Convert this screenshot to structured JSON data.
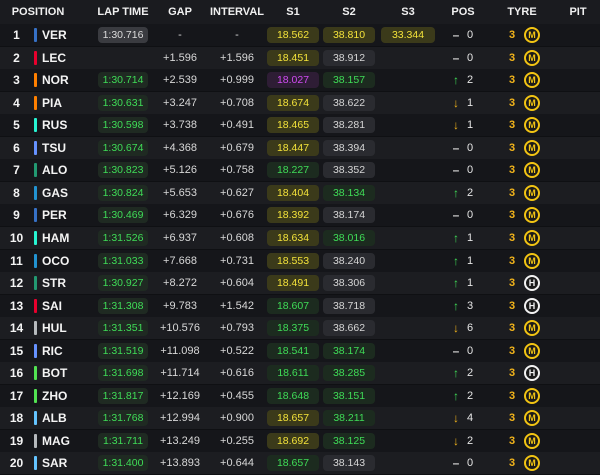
{
  "header": {
    "position": "POSITION",
    "lap_time": "LAP TIME",
    "gap": "GAP",
    "interval": "INTERVAL",
    "s1": "S1",
    "s2": "S2",
    "s3": "S3",
    "pos": "POS",
    "tyre": "TYRE",
    "pit": "PIT"
  },
  "colors": {
    "yellow_sector": "#f3e23a",
    "green_sector": "#3fdc57",
    "purple_sector": "#d04bf2",
    "medium_tyre": "#f2c413",
    "hard_tyre": "#f2f2f2"
  },
  "rows": [
    {
      "pos": "1",
      "driver": "VER",
      "team_color": "#3671c6",
      "lap": "1:30.716",
      "lap_style": "best",
      "gap": "-",
      "interval": "-",
      "s1": "18.562",
      "s1c": "yellow",
      "s2": "38.810",
      "s2c": "yellow",
      "s3": "33.344",
      "s3c": "yellow",
      "change_icon": "same",
      "change": "0",
      "tyre_laps": "3",
      "tyre": "M",
      "tyre_type": "medium"
    },
    {
      "pos": "2",
      "driver": "LEC",
      "team_color": "#e8002d",
      "lap": "",
      "lap_style": "none",
      "gap": "+1.596",
      "interval": "+1.596",
      "s1": "18.451",
      "s1c": "yellow",
      "s2": "38.912",
      "s2c": "grey",
      "s3": "",
      "s3c": "none",
      "change_icon": "same",
      "change": "0",
      "tyre_laps": "3",
      "tyre": "M",
      "tyre_type": "medium"
    },
    {
      "pos": "3",
      "driver": "NOR",
      "team_color": "#ff8000",
      "lap": "1:30.714",
      "lap_style": "pb",
      "gap": "+2.539",
      "interval": "+0.999",
      "s1": "18.027",
      "s1c": "purple",
      "s2": "38.157",
      "s2c": "green",
      "s3": "",
      "s3c": "none",
      "change_icon": "up",
      "change": "2",
      "tyre_laps": "3",
      "tyre": "M",
      "tyre_type": "medium"
    },
    {
      "pos": "4",
      "driver": "PIA",
      "team_color": "#ff8000",
      "lap": "1:30.631",
      "lap_style": "pb",
      "gap": "+3.247",
      "interval": "+0.708",
      "s1": "18.674",
      "s1c": "yellow",
      "s2": "38.622",
      "s2c": "grey",
      "s3": "",
      "s3c": "none",
      "change_icon": "down",
      "change": "1",
      "tyre_laps": "3",
      "tyre": "M",
      "tyre_type": "medium"
    },
    {
      "pos": "5",
      "driver": "RUS",
      "team_color": "#27f4d2",
      "lap": "1:30.598",
      "lap_style": "pb",
      "gap": "+3.738",
      "interval": "+0.491",
      "s1": "18.465",
      "s1c": "yellow",
      "s2": "38.281",
      "s2c": "grey",
      "s3": "",
      "s3c": "none",
      "change_icon": "down",
      "change": "1",
      "tyre_laps": "3",
      "tyre": "M",
      "tyre_type": "medium"
    },
    {
      "pos": "6",
      "driver": "TSU",
      "team_color": "#6692ff",
      "lap": "1:30.674",
      "lap_style": "pb",
      "gap": "+4.368",
      "interval": "+0.679",
      "s1": "18.447",
      "s1c": "yellow",
      "s2": "38.394",
      "s2c": "grey",
      "s3": "",
      "s3c": "none",
      "change_icon": "same",
      "change": "0",
      "tyre_laps": "3",
      "tyre": "M",
      "tyre_type": "medium"
    },
    {
      "pos": "7",
      "driver": "ALO",
      "team_color": "#229971",
      "lap": "1:30.823",
      "lap_style": "pb",
      "gap": "+5.126",
      "interval": "+0.758",
      "s1": "18.227",
      "s1c": "green",
      "s2": "38.352",
      "s2c": "grey",
      "s3": "",
      "s3c": "none",
      "change_icon": "same",
      "change": "0",
      "tyre_laps": "3",
      "tyre": "M",
      "tyre_type": "medium"
    },
    {
      "pos": "8",
      "driver": "GAS",
      "team_color": "#2293d1",
      "lap": "1:30.824",
      "lap_style": "pb",
      "gap": "+5.653",
      "interval": "+0.627",
      "s1": "18.404",
      "s1c": "yellow",
      "s2": "38.134",
      "s2c": "green",
      "s3": "",
      "s3c": "none",
      "change_icon": "up",
      "change": "2",
      "tyre_laps": "3",
      "tyre": "M",
      "tyre_type": "medium"
    },
    {
      "pos": "9",
      "driver": "PER",
      "team_color": "#3671c6",
      "lap": "1:30.469",
      "lap_style": "pb",
      "gap": "+6.329",
      "interval": "+0.676",
      "s1": "18.392",
      "s1c": "yellow",
      "s2": "38.174",
      "s2c": "grey",
      "s3": "",
      "s3c": "none",
      "change_icon": "same",
      "change": "0",
      "tyre_laps": "3",
      "tyre": "M",
      "tyre_type": "medium"
    },
    {
      "pos": "10",
      "driver": "HAM",
      "team_color": "#27f4d2",
      "lap": "1:31.526",
      "lap_style": "pb",
      "gap": "+6.937",
      "interval": "+0.608",
      "s1": "18.634",
      "s1c": "yellow",
      "s2": "38.016",
      "s2c": "green",
      "s3": "",
      "s3c": "none",
      "change_icon": "up",
      "change": "1",
      "tyre_laps": "3",
      "tyre": "M",
      "tyre_type": "medium"
    },
    {
      "pos": "11",
      "driver": "OCO",
      "team_color": "#2293d1",
      "lap": "1:31.033",
      "lap_style": "pb",
      "gap": "+7.668",
      "interval": "+0.731",
      "s1": "18.553",
      "s1c": "yellow",
      "s2": "38.240",
      "s2c": "grey",
      "s3": "",
      "s3c": "none",
      "change_icon": "up",
      "change": "1",
      "tyre_laps": "3",
      "tyre": "M",
      "tyre_type": "medium"
    },
    {
      "pos": "12",
      "driver": "STR",
      "team_color": "#229971",
      "lap": "1:30.927",
      "lap_style": "pb",
      "gap": "+8.272",
      "interval": "+0.604",
      "s1": "18.491",
      "s1c": "yellow",
      "s2": "38.306",
      "s2c": "grey",
      "s3": "",
      "s3c": "none",
      "change_icon": "up",
      "change": "1",
      "tyre_laps": "3",
      "tyre": "H",
      "tyre_type": "hard"
    },
    {
      "pos": "13",
      "driver": "SAI",
      "team_color": "#e8002d",
      "lap": "1:31.308",
      "lap_style": "pb",
      "gap": "+9.783",
      "interval": "+1.542",
      "s1": "18.607",
      "s1c": "green",
      "s2": "38.718",
      "s2c": "grey",
      "s3": "",
      "s3c": "none",
      "change_icon": "up",
      "change": "3",
      "tyre_laps": "3",
      "tyre": "H",
      "tyre_type": "hard"
    },
    {
      "pos": "14",
      "driver": "HUL",
      "team_color": "#b6babd",
      "lap": "1:31.351",
      "lap_style": "pb",
      "gap": "+10.576",
      "interval": "+0.793",
      "s1": "18.375",
      "s1c": "green",
      "s2": "38.662",
      "s2c": "grey",
      "s3": "",
      "s3c": "none",
      "change_icon": "down",
      "change": "6",
      "tyre_laps": "3",
      "tyre": "M",
      "tyre_type": "medium"
    },
    {
      "pos": "15",
      "driver": "RIC",
      "team_color": "#6692ff",
      "lap": "1:31.519",
      "lap_style": "pb",
      "gap": "+11.098",
      "interval": "+0.522",
      "s1": "18.541",
      "s1c": "green",
      "s2": "38.174",
      "s2c": "green",
      "s3": "",
      "s3c": "none",
      "change_icon": "same",
      "change": "0",
      "tyre_laps": "3",
      "tyre": "M",
      "tyre_type": "medium"
    },
    {
      "pos": "16",
      "driver": "BOT",
      "team_color": "#52e252",
      "lap": "1:31.698",
      "lap_style": "pb",
      "gap": "+11.714",
      "interval": "+0.616",
      "s1": "18.611",
      "s1c": "green",
      "s2": "38.285",
      "s2c": "green",
      "s3": "",
      "s3c": "none",
      "change_icon": "up",
      "change": "2",
      "tyre_laps": "3",
      "tyre": "H",
      "tyre_type": "hard"
    },
    {
      "pos": "17",
      "driver": "ZHO",
      "team_color": "#52e252",
      "lap": "1:31.817",
      "lap_style": "pb",
      "gap": "+12.169",
      "interval": "+0.455",
      "s1": "18.648",
      "s1c": "green",
      "s2": "38.151",
      "s2c": "green",
      "s3": "",
      "s3c": "none",
      "change_icon": "up",
      "change": "2",
      "tyre_laps": "3",
      "tyre": "M",
      "tyre_type": "medium"
    },
    {
      "pos": "18",
      "driver": "ALB",
      "team_color": "#64c4ff",
      "lap": "1:31.768",
      "lap_style": "pb",
      "gap": "+12.994",
      "interval": "+0.900",
      "s1": "18.657",
      "s1c": "yellow",
      "s2": "38.211",
      "s2c": "green",
      "s3": "",
      "s3c": "none",
      "change_icon": "down",
      "change": "4",
      "tyre_laps": "3",
      "tyre": "M",
      "tyre_type": "medium"
    },
    {
      "pos": "19",
      "driver": "MAG",
      "team_color": "#b6babd",
      "lap": "1:31.711",
      "lap_style": "pb",
      "gap": "+13.249",
      "interval": "+0.255",
      "s1": "18.692",
      "s1c": "yellow",
      "s2": "38.125",
      "s2c": "green",
      "s3": "",
      "s3c": "none",
      "change_icon": "down",
      "change": "2",
      "tyre_laps": "3",
      "tyre": "M",
      "tyre_type": "medium"
    },
    {
      "pos": "20",
      "driver": "SAR",
      "team_color": "#64c4ff",
      "lap": "1:31.400",
      "lap_style": "pb",
      "gap": "+13.893",
      "interval": "+0.644",
      "s1": "18.657",
      "s1c": "green",
      "s2": "38.143",
      "s2c": "grey",
      "s3": "",
      "s3c": "none",
      "change_icon": "same",
      "change": "0",
      "tyre_laps": "3",
      "tyre": "M",
      "tyre_type": "medium"
    }
  ]
}
